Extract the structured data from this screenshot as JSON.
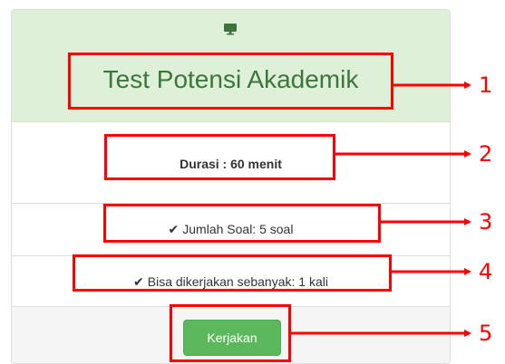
{
  "card": {
    "icon": "desktop-monitor-icon",
    "title": "Test Potensi Akademik",
    "durasi": "Durasi : 60 menit",
    "jumlah_soal": "Jumlah Soal: 5 soal",
    "bisa_dikerjakan": "Bisa dikerjakan sebanyak: 1 kali",
    "check_icon": "check-icon",
    "button_label": "Kerjakan"
  },
  "annotations": {
    "labels": [
      "1",
      "2",
      "3",
      "4",
      "5"
    ],
    "color": "#ff0000"
  },
  "colors": {
    "header_bg": "#dff0d8",
    "title_text": "#3c763d",
    "button_bg": "#5cb85c",
    "footer_bg": "#f5f5f5"
  }
}
